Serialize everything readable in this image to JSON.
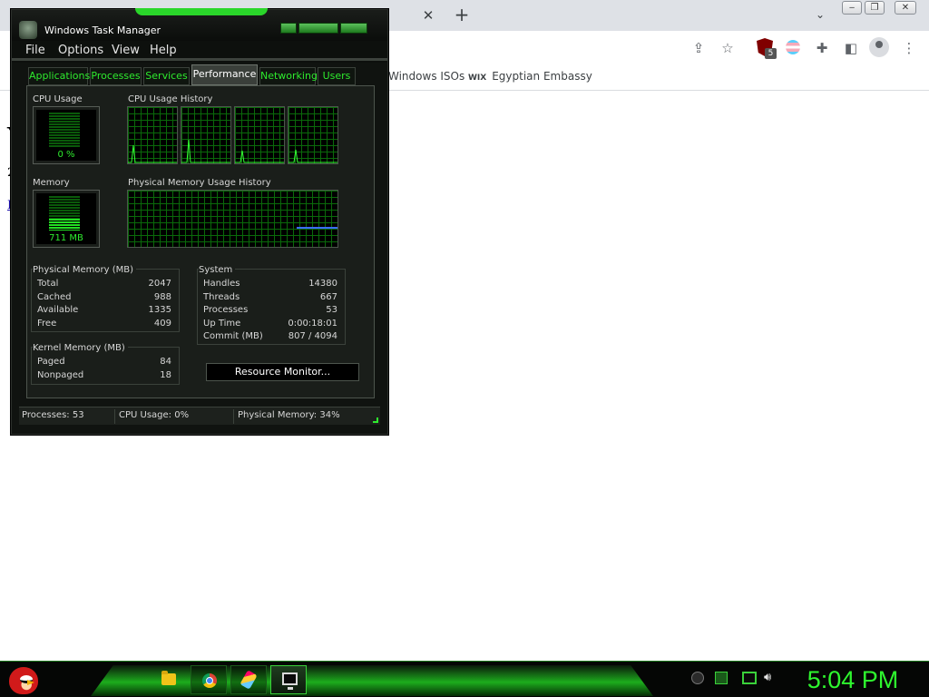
{
  "browser": {
    "tab_close_icon": "close-icon",
    "new_tab_icon": "plus-icon",
    "bookmarks": [
      {
        "label": "Windows ISOs"
      },
      {
        "label": "Egyptian Embassy",
        "icon_text": "WIX"
      }
    ],
    "extension_badge": "5",
    "page_fragments": [
      "Y",
      "2",
      "F"
    ]
  },
  "task_manager": {
    "title": "Windows Task Manager",
    "menu": [
      "File",
      "Options",
      "View",
      "Help"
    ],
    "tabs": [
      "Applications",
      "Processes",
      "Services",
      "Performance",
      "Networking",
      "Users"
    ],
    "active_tab": "Performance",
    "cpu_usage_label": "CPU Usage",
    "cpu_usage_value": "0 %",
    "cpu_usage_fraction": 0.0,
    "cpu_history_label": "CPU Usage History",
    "memory_label": "Memory",
    "memory_value": "711 MB",
    "memory_fraction": 0.34,
    "memory_history_label": "Physical Memory Usage History",
    "physical_memory": {
      "title": "Physical Memory (MB)",
      "rows": [
        {
          "k": "Total",
          "v": "2047"
        },
        {
          "k": "Cached",
          "v": "988"
        },
        {
          "k": "Available",
          "v": "1335"
        },
        {
          "k": "Free",
          "v": "409"
        }
      ]
    },
    "kernel_memory": {
      "title": "Kernel Memory (MB)",
      "rows": [
        {
          "k": "Paged",
          "v": "84"
        },
        {
          "k": "Nonpaged",
          "v": "18"
        }
      ]
    },
    "system": {
      "title": "System",
      "rows": [
        {
          "k": "Handles",
          "v": "14380"
        },
        {
          "k": "Threads",
          "v": "667"
        },
        {
          "k": "Processes",
          "v": "53"
        },
        {
          "k": "Up Time",
          "v": "0:00:18:01"
        },
        {
          "k": "Commit (MB)",
          "v": "807 / 4094"
        }
      ]
    },
    "resource_monitor_label": "Resource Monitor...",
    "status": {
      "processes": "Processes: 53",
      "cpu": "CPU Usage: 0%",
      "memory": "Physical Memory: 34%"
    },
    "colors": {
      "accent": "#2eea2e",
      "background": "#101310",
      "memory_line": "#3b6cff"
    }
  },
  "taskbar": {
    "start_icon": "angry-bird-icon",
    "apps": [
      "folder-icon",
      "chrome-icon",
      "paint-brush-icon",
      "task-manager-icon"
    ],
    "tray_icons": [
      "keyboard-icon",
      "green-square-icon",
      "monitor-icon",
      "speaker-icon"
    ],
    "clock": "5:04 PM"
  }
}
